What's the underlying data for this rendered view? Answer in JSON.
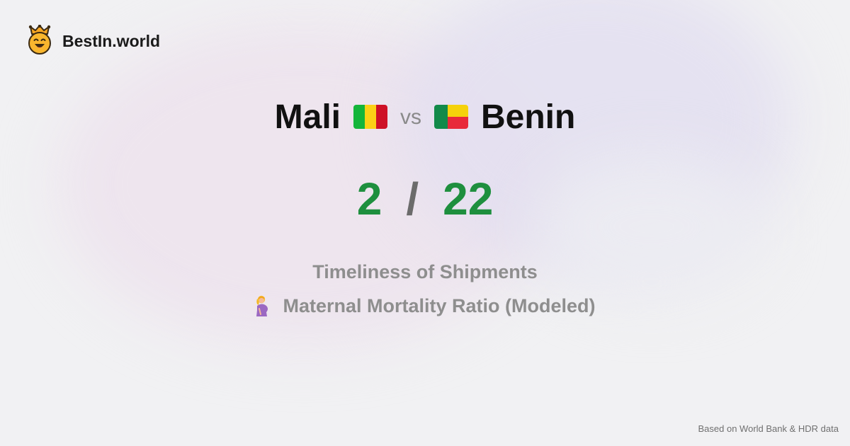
{
  "brand": {
    "name": "BestIn.world",
    "logo_icon": "crowned-smiley-icon"
  },
  "comparison": {
    "left_country": "Mali",
    "vs": "vs",
    "right_country": "Benin",
    "left_flag_colors": [
      "#14b53a",
      "#fcd116",
      "#ce1126"
    ],
    "right_flag_colors": [
      "#128a4a",
      "#f5d20b",
      "#e82a3a"
    ]
  },
  "score": {
    "left": "2",
    "separator": "/",
    "right": "22",
    "color": "#1e8f3e"
  },
  "metrics": [
    {
      "label": "Timeliness of Shipments"
    },
    {
      "icon": "pregnant-woman-icon",
      "label": "Maternal Mortality Ratio (Modeled)"
    }
  ],
  "footer": {
    "source": "Based on World Bank & HDR data"
  }
}
